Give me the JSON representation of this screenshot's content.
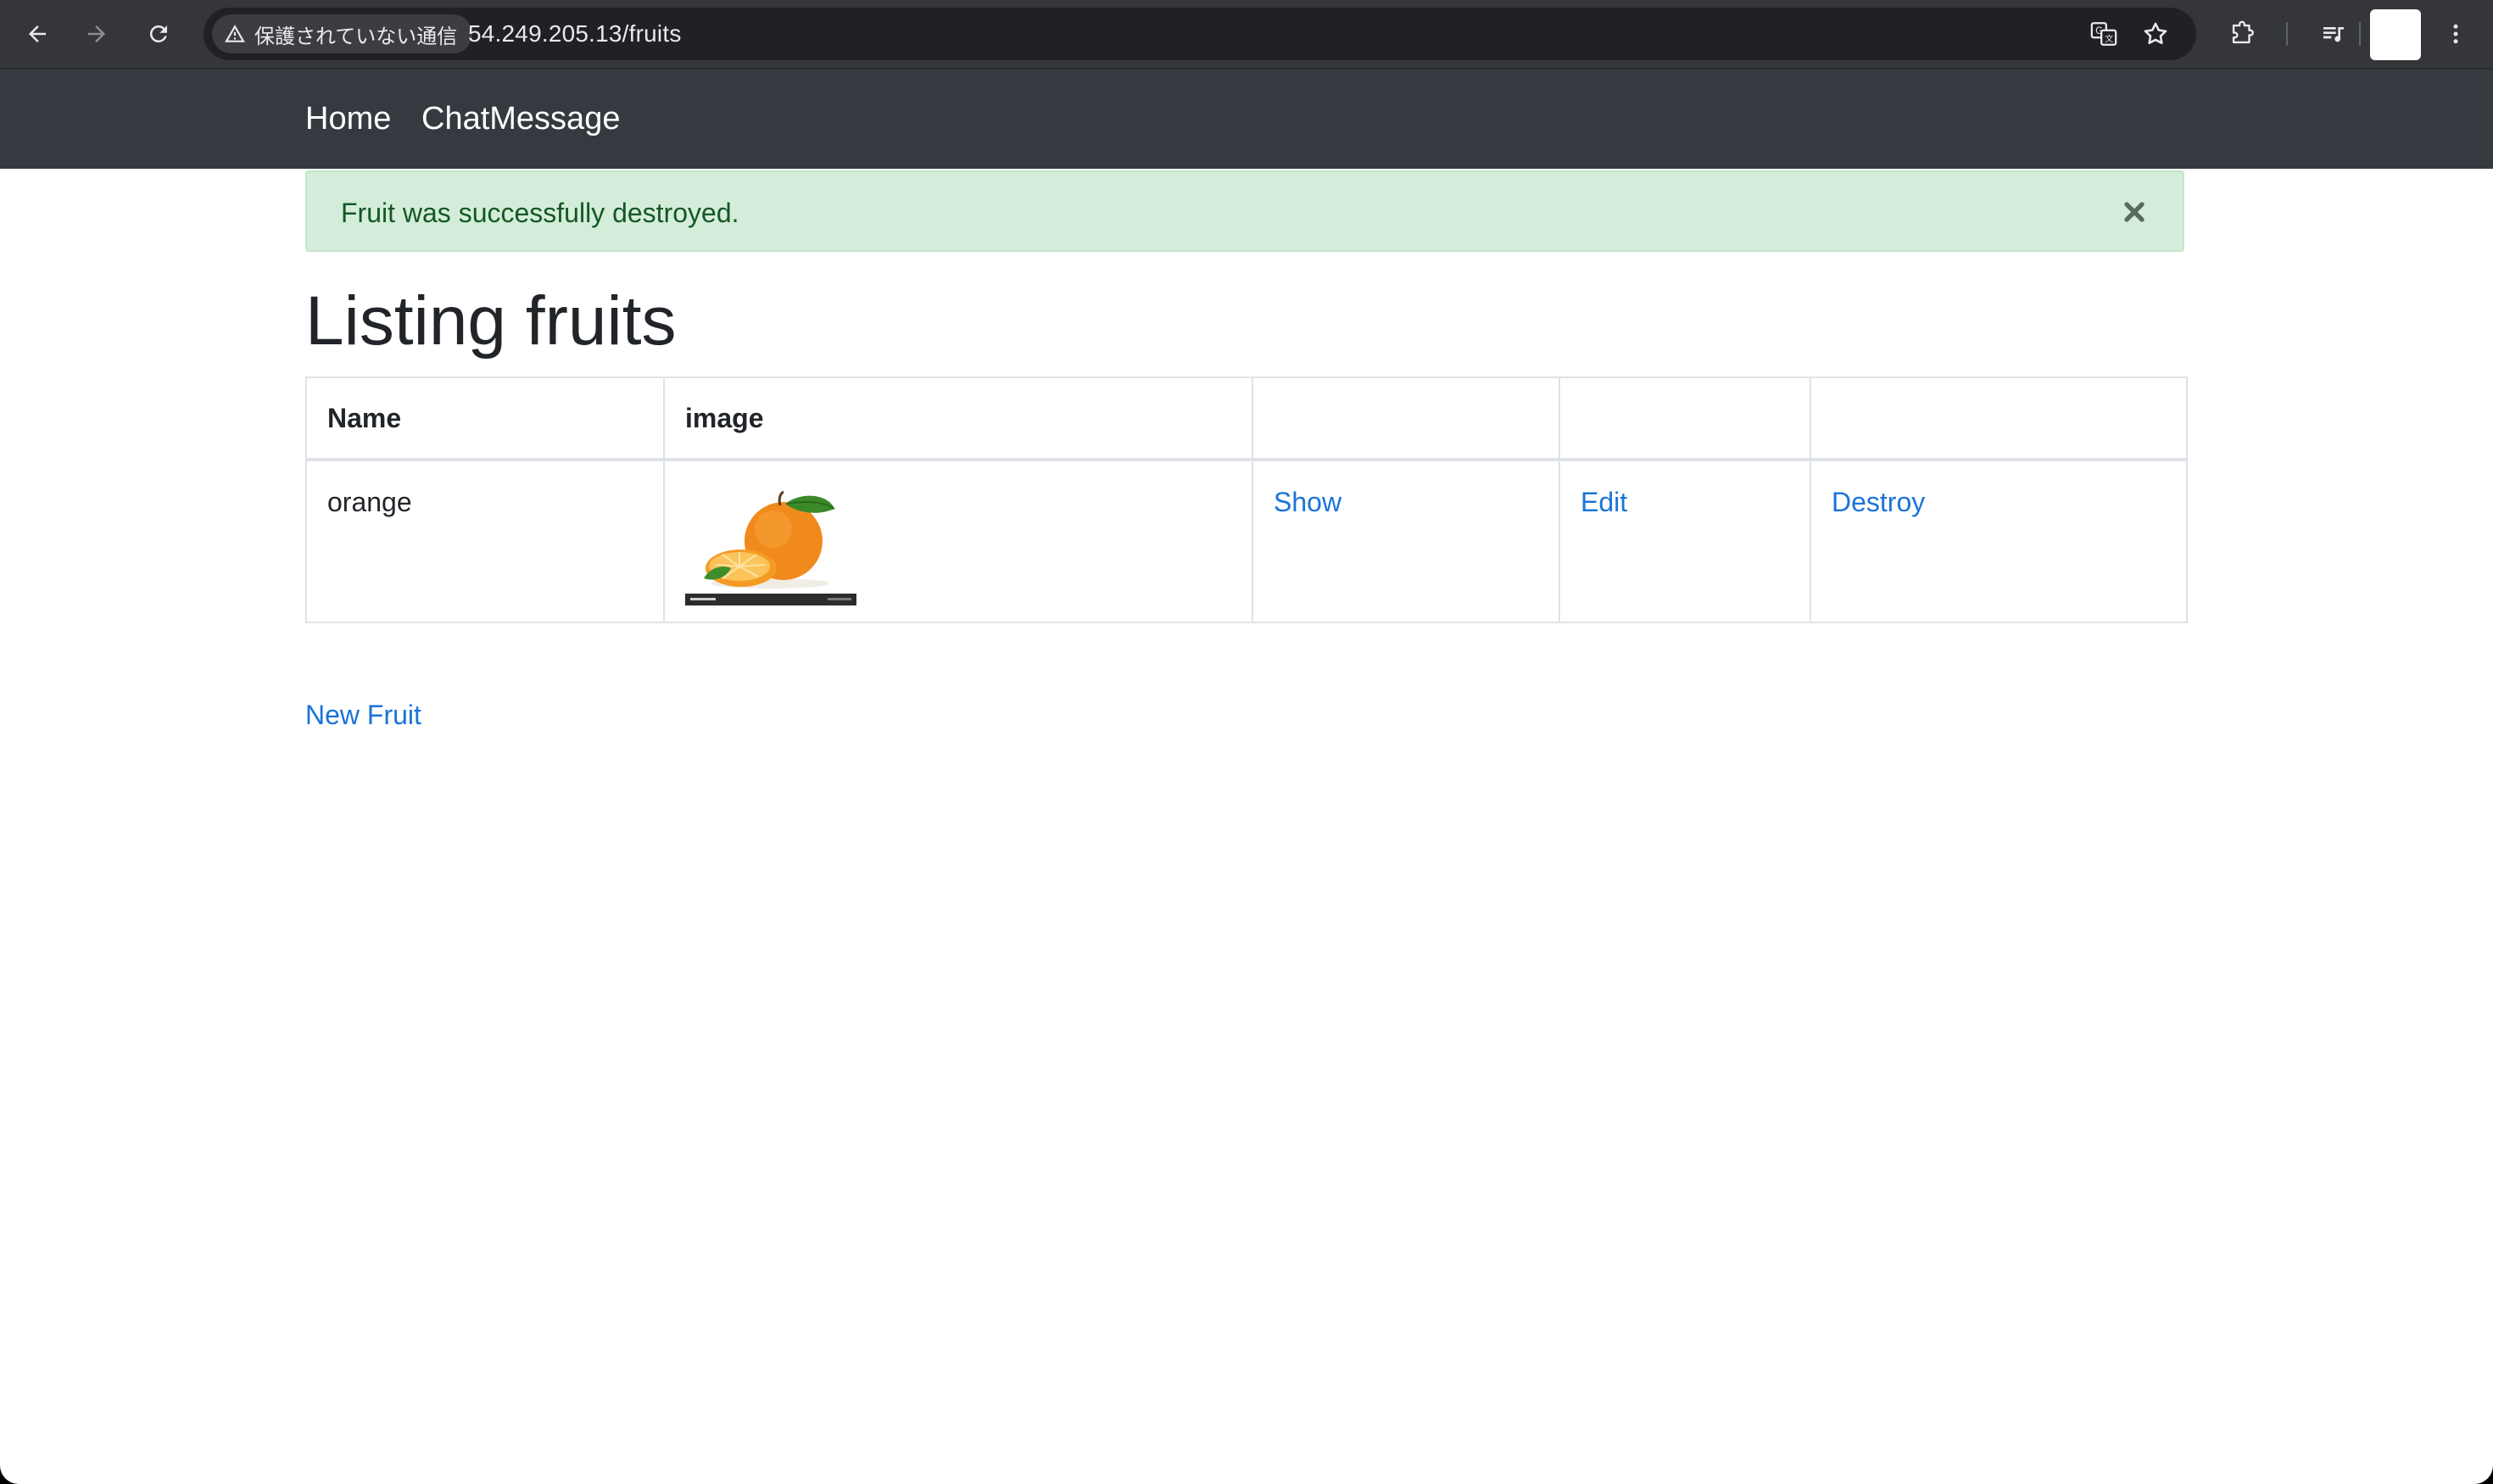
{
  "browser": {
    "security_label": "保護されていない通信",
    "url": "54.249.205.13/fruits",
    "icons": [
      "back-arrow-icon",
      "forward-arrow-icon",
      "reload-icon",
      "warning-triangle-icon",
      "translate-icon",
      "bookmark-star-icon",
      "extensions-puzzle-icon",
      "media-queue-icon",
      "kebab-menu-icon"
    ]
  },
  "navbar": {
    "links": [
      {
        "label": "Home"
      },
      {
        "label": "ChatMessage"
      }
    ]
  },
  "alert": {
    "message": "Fruit was successfully destroyed.",
    "close_icon": "close-x-icon",
    "color": "#155724",
    "background": "#d4edda"
  },
  "page": {
    "title": "Listing fruits"
  },
  "table": {
    "headers": [
      "Name",
      "image",
      "",
      "",
      ""
    ],
    "rows": [
      {
        "name": "orange",
        "image_alt": "orange-fruit-image",
        "actions": {
          "show": "Show",
          "edit": "Edit",
          "destroy": "Destroy"
        }
      }
    ]
  },
  "footer_links": {
    "new_fruit": "New Fruit"
  },
  "colors": {
    "navbar": "#343a40",
    "link": "#1a73d8",
    "chrome": "#35363a"
  }
}
